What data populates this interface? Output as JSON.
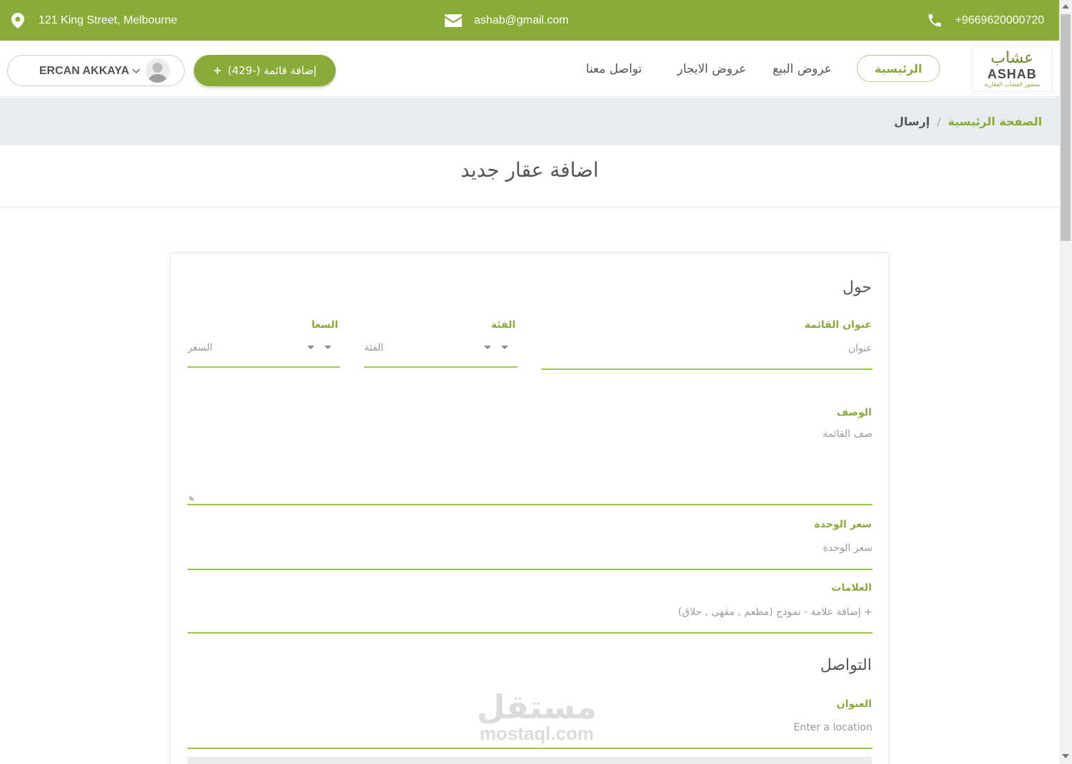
{
  "topbar": {
    "address": "121 King Street, Melbourne",
    "email": "ashab@gmail.com",
    "phone": "+9669620000720"
  },
  "logo": {
    "arabic": "عشاب",
    "english": "ASHAB",
    "tagline": "منصور العشاب العقارية"
  },
  "nav": {
    "home": "الرئيسية",
    "sale": "عروض البيع",
    "rent": "عروض الايجار",
    "contact": "تواصل معنا",
    "add_listing": "إضافة قائمة (-429)",
    "add_icon": "+",
    "user_name": "ERCAN AKKAYA"
  },
  "breadcrumb": {
    "home": "الصفحة الرئيسية",
    "separator": "/",
    "current": "إرسال"
  },
  "page_title": "اضافة عقار جديد",
  "form": {
    "section_about": "حول",
    "listing_title_label": "عنوان القائمة",
    "listing_title_placeholder": "عنوان",
    "category_label": "الفئة",
    "category_placeholder": "الفئة",
    "price_label": "السعا",
    "price_placeholder": "السعر",
    "description_label": "الوصف",
    "description_placeholder": "صف القائمة",
    "unit_price_label": "سعر الوحدة",
    "unit_price_placeholder": "سعر الوحدة",
    "tags_label": "العلامات",
    "tags_placeholder": "+ إضافة علامة - نموذج (مطعم , مقهى , حلاق)",
    "section_contact": "التواصل",
    "address_label": "العنوان",
    "address_placeholder": "Enter a location"
  },
  "watermark": {
    "arabic": "مستقل",
    "english": "mostaql.com"
  },
  "colors": {
    "accent": "#89ab37",
    "field_line": "#9fc74a",
    "crumb_bg": "#e9ecef"
  }
}
